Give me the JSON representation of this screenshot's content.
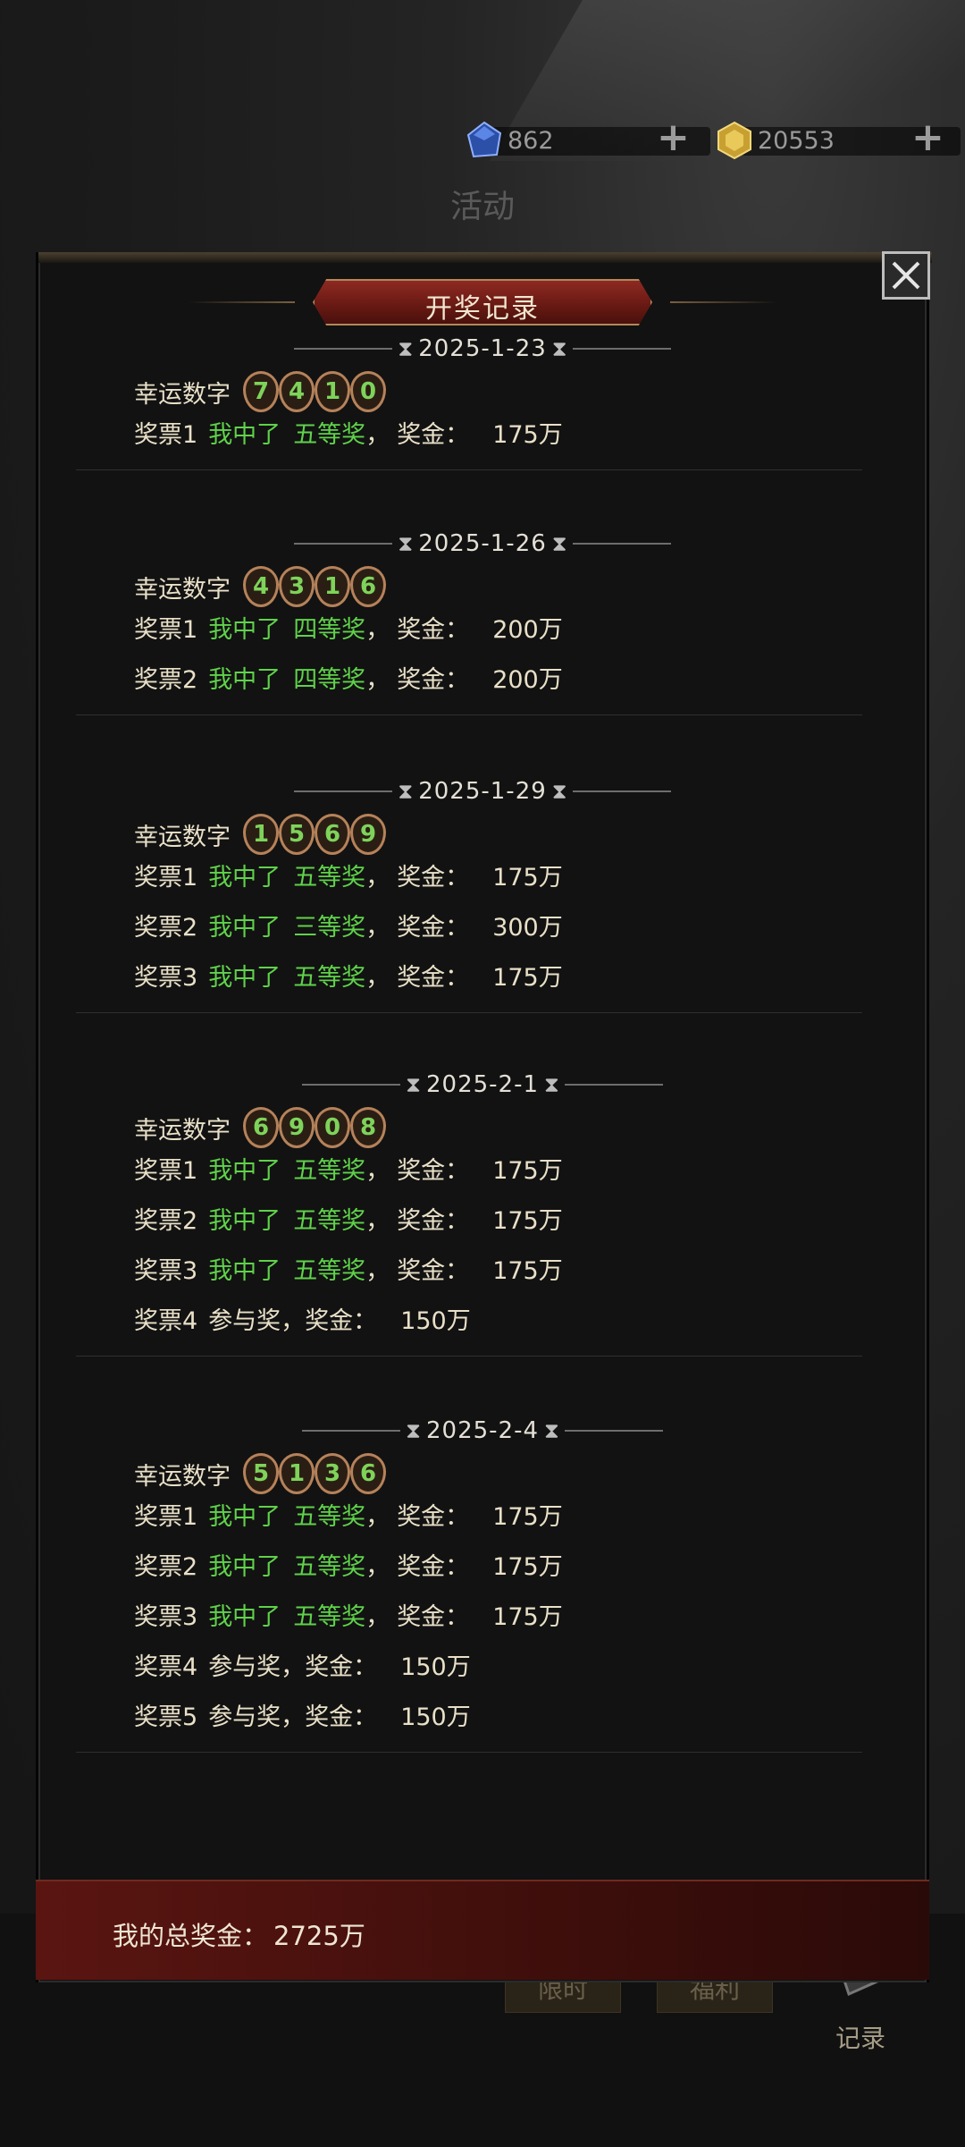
{
  "header": {
    "currencies": [
      {
        "icon": "blue-gem-icon",
        "value": "862"
      },
      {
        "icon": "gold-coin-icon",
        "value": "20553"
      }
    ],
    "page_title": "活动"
  },
  "modal": {
    "title": "开奖记录",
    "close_icon": "close-icon",
    "records": [
      {
        "date": "2025-1-23",
        "lucky_label": "幸运数字",
        "lucky_numbers": [
          "7",
          "4",
          "1",
          "0"
        ],
        "tickets": [
          {
            "name": "奖票1",
            "result": "我中了",
            "rank": "五等奖",
            "sep": "，",
            "prize_label": "奖金：",
            "amount": "175万"
          }
        ]
      },
      {
        "date": "2025-1-26",
        "lucky_label": "幸运数字",
        "lucky_numbers": [
          "4",
          "3",
          "1",
          "6"
        ],
        "tickets": [
          {
            "name": "奖票1",
            "result": "我中了",
            "rank": "四等奖",
            "sep": "，",
            "prize_label": "奖金：",
            "amount": "200万"
          },
          {
            "name": "奖票2",
            "result": "我中了",
            "rank": "四等奖",
            "sep": "，",
            "prize_label": "奖金：",
            "amount": "200万"
          }
        ]
      },
      {
        "date": "2025-1-29",
        "lucky_label": "幸运数字",
        "lucky_numbers": [
          "1",
          "5",
          "6",
          "9"
        ],
        "tickets": [
          {
            "name": "奖票1",
            "result": "我中了",
            "rank": "五等奖",
            "sep": "，",
            "prize_label": "奖金：",
            "amount": "175万"
          },
          {
            "name": "奖票2",
            "result": "我中了",
            "rank": "三等奖",
            "sep": "，",
            "prize_label": "奖金：",
            "amount": "300万"
          },
          {
            "name": "奖票3",
            "result": "我中了",
            "rank": "五等奖",
            "sep": "，",
            "prize_label": "奖金：",
            "amount": "175万"
          }
        ]
      },
      {
        "date": "2025-2-1",
        "lucky_label": "幸运数字",
        "lucky_numbers": [
          "6",
          "9",
          "0",
          "8"
        ],
        "tickets": [
          {
            "name": "奖票1",
            "result": "我中了",
            "rank": "五等奖",
            "sep": "，",
            "prize_label": "奖金：",
            "amount": "175万"
          },
          {
            "name": "奖票2",
            "result": "我中了",
            "rank": "五等奖",
            "sep": "，",
            "prize_label": "奖金：",
            "amount": "175万"
          },
          {
            "name": "奖票3",
            "result": "我中了",
            "rank": "五等奖",
            "sep": "，",
            "prize_label": "奖金：",
            "amount": "175万"
          },
          {
            "name": "奖票4",
            "consolation": "参与奖，",
            "prize_label": "奖金：",
            "amount": "150万"
          }
        ]
      },
      {
        "date": "2025-2-4",
        "lucky_label": "幸运数字",
        "lucky_numbers": [
          "5",
          "1",
          "3",
          "6"
        ],
        "tickets": [
          {
            "name": "奖票1",
            "result": "我中了",
            "rank": "五等奖",
            "sep": "，",
            "prize_label": "奖金：",
            "amount": "175万"
          },
          {
            "name": "奖票2",
            "result": "我中了",
            "rank": "五等奖",
            "sep": "，",
            "prize_label": "奖金：",
            "amount": "175万"
          },
          {
            "name": "奖票3",
            "result": "我中了",
            "rank": "五等奖",
            "sep": "，",
            "prize_label": "奖金：",
            "amount": "175万"
          },
          {
            "name": "奖票4",
            "consolation": "参与奖，",
            "prize_label": "奖金：",
            "amount": "150万"
          },
          {
            "name": "奖票5",
            "consolation": "参与奖，",
            "prize_label": "奖金：",
            "amount": "150万"
          }
        ]
      }
    ],
    "footer": {
      "total_label": "我的总奖金：",
      "total_value": "2725万"
    }
  },
  "bottom_nav": {
    "tabs": [
      "限时",
      "福利"
    ],
    "record_label": "记录"
  },
  "colors": {
    "accent_green": "#5fd24a",
    "banner_red": "#8e2a22",
    "ball_ring": "#b6825a"
  }
}
